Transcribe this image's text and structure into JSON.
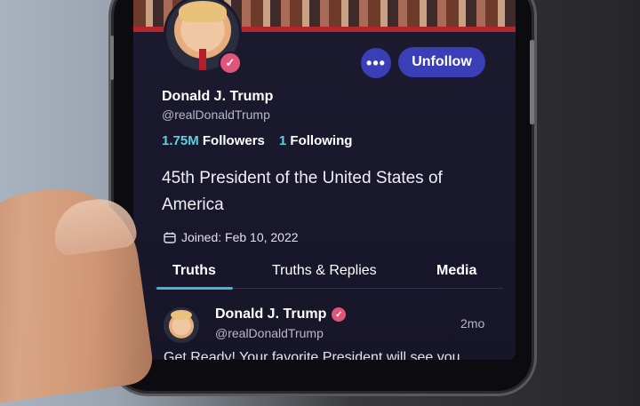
{
  "profile": {
    "display_name": "Donald J. Trump",
    "handle": "@realDonaldTrump",
    "followers_count": "1.75M",
    "followers_label": "Followers",
    "following_count": "1",
    "following_label": "Following",
    "bio": "45th President of the United States of America",
    "joined": "Joined: Feb 10, 2022",
    "unfollow_label": "Unfollow",
    "more_label": "•••",
    "verified_mark": "✓"
  },
  "tabs": [
    {
      "label": "Truths",
      "active": true
    },
    {
      "label": "Truths & Replies",
      "active": false
    },
    {
      "label": "Media",
      "active": false
    }
  ],
  "post": {
    "author": "Donald J. Trump",
    "handle": "@realDonaldTrump",
    "time": "2mo",
    "text": "Get Ready! Your favorite President will see you"
  },
  "icons": {
    "calendar": "calendar-icon",
    "verified": "verified-badge-icon",
    "more": "more-dots-icon"
  },
  "colors": {
    "accent": "#3a3fb8",
    "link": "#5fd0df",
    "verified": "#e0567a",
    "background": "#1c1a30"
  }
}
